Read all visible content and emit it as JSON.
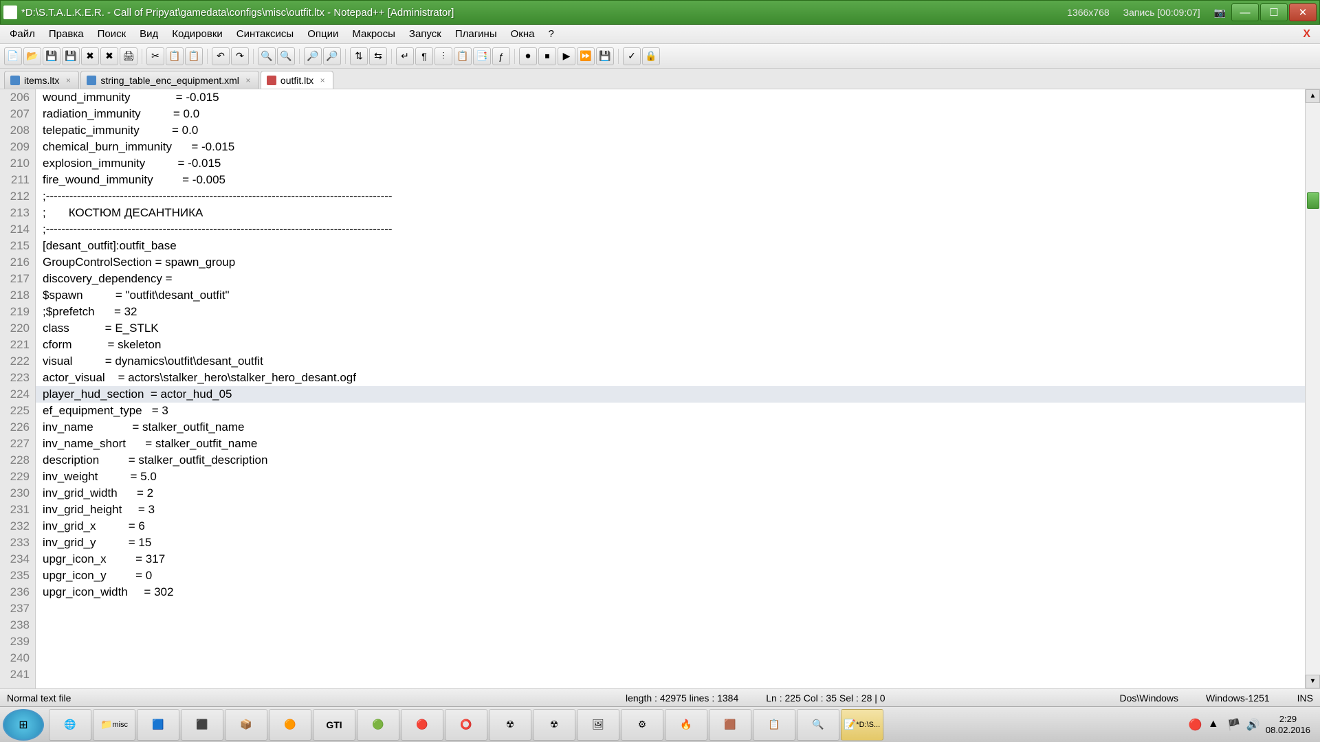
{
  "window": {
    "title": "*D:\\S.T.A.L.K.E.R. - Call of Pripyat\\gamedata\\configs\\misc\\outfit.ltx - Notepad++ [Administrator]",
    "overlay_res": "1366x768",
    "overlay_rec": "Запись [00:09:07]"
  },
  "menu": {
    "file": "Файл",
    "edit": "Правка",
    "search": "Поиск",
    "view": "Вид",
    "encoding": "Кодировки",
    "syntax": "Синтаксисы",
    "options": "Опции",
    "macros": "Макросы",
    "run": "Запуск",
    "plugins": "Плагины",
    "windows": "Окна",
    "help": "?"
  },
  "tabs": [
    {
      "label": "items.ltx",
      "modified": false
    },
    {
      "label": "string_table_enc_equipment.xml",
      "modified": false
    },
    {
      "label": "outfit.ltx",
      "modified": true,
      "active": true
    }
  ],
  "lines": [
    {
      "n": 206,
      "t": "wound_immunity              = -0.015"
    },
    {
      "n": 207,
      "t": "radiation_immunity          = 0.0"
    },
    {
      "n": 208,
      "t": "telepatic_immunity          = 0.0"
    },
    {
      "n": 209,
      "t": "chemical_burn_immunity      = -0.015"
    },
    {
      "n": 210,
      "t": "explosion_immunity          = -0.015"
    },
    {
      "n": 211,
      "t": "fire_wound_immunity         = -0.005"
    },
    {
      "n": 212,
      "t": ""
    },
    {
      "n": 213,
      "t": ";-----------------------------------------------------------------------------------------"
    },
    {
      "n": 214,
      "t": ";       КОСТЮМ ДЕСАНТНИКА"
    },
    {
      "n": 215,
      "t": ";-----------------------------------------------------------------------------------------"
    },
    {
      "n": 216,
      "t": "[desant_outfit]:outfit_base"
    },
    {
      "n": 217,
      "t": "GroupControlSection = spawn_group"
    },
    {
      "n": 218,
      "t": "discovery_dependency = "
    },
    {
      "n": 219,
      "t": "$spawn          = \"outfit\\desant_outfit\""
    },
    {
      "n": 220,
      "t": ";$prefetch      = 32"
    },
    {
      "n": 221,
      "t": "class           = E_STLK"
    },
    {
      "n": 222,
      "t": "cform           = skeleton"
    },
    {
      "n": 223,
      "t": "visual          = dynamics\\outfit\\desant_outfit"
    },
    {
      "n": 224,
      "t": "actor_visual    = actors\\stalker_hero\\stalker_hero_desant.ogf"
    },
    {
      "n": 225,
      "t": "player_hud_section  = actor_hud_05",
      "hl": true
    },
    {
      "n": 226,
      "t": ""
    },
    {
      "n": 227,
      "t": "ef_equipment_type   = 3"
    },
    {
      "n": 228,
      "t": ""
    },
    {
      "n": 229,
      "t": "inv_name            = stalker_outfit_name"
    },
    {
      "n": 230,
      "t": "inv_name_short      = stalker_outfit_name"
    },
    {
      "n": 231,
      "t": "description         = stalker_outfit_description"
    },
    {
      "n": 232,
      "t": ""
    },
    {
      "n": 233,
      "t": "inv_weight          = 5.0"
    },
    {
      "n": 234,
      "t": ""
    },
    {
      "n": 235,
      "t": "inv_grid_width      = 2"
    },
    {
      "n": 236,
      "t": "inv_grid_height     = 3"
    },
    {
      "n": 237,
      "t": "inv_grid_x          = 6"
    },
    {
      "n": 238,
      "t": "inv_grid_y          = 15"
    },
    {
      "n": 239,
      "t": "upgr_icon_x         = 317"
    },
    {
      "n": 240,
      "t": "upgr_icon_y         = 0"
    },
    {
      "n": 241,
      "t": "upgr_icon_width     = 302"
    }
  ],
  "status": {
    "filetype": "Normal text file",
    "length": "length : 42975    lines : 1384",
    "pos": "Ln : 225    Col : 35    Sel : 28 | 0",
    "eol": "Dos\\Windows",
    "enc": "Windows-1251",
    "ins": "INS"
  },
  "taskbar": {
    "explorer_label": "misc",
    "active_label": "*D:\\S...",
    "time": "2:29",
    "date": "08.02.2016"
  }
}
